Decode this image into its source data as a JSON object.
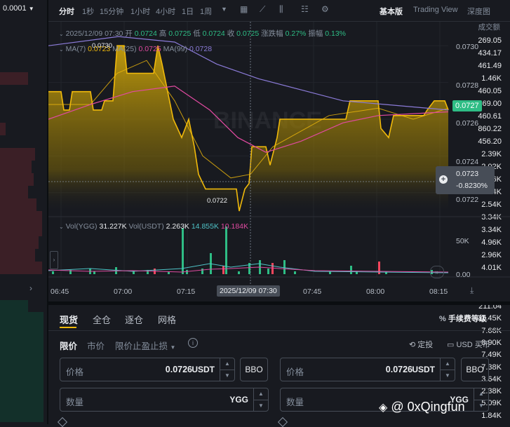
{
  "orderbook": {
    "precision": "0.0001",
    "header": "成交额",
    "asks": [
      "269.05",
      "434.17",
      "461.49",
      "1.46K",
      "460.05",
      "469.00",
      "460.61",
      "860.22",
      "456.20",
      "2.39K",
      "2.02K",
      "1.96K",
      "1.84K",
      "2.54K",
      "3.34K",
      "3.34K",
      "4.96K",
      "2.96K",
      "4.01K"
    ],
    "bids": [
      "211.04",
      "11.45K",
      "7.66K",
      "8.90K",
      "7.49K",
      "7.38K",
      "3.64K",
      "2.38K",
      "5.09K",
      "1.84K"
    ]
  },
  "toolbar": {
    "intervals": [
      "分时",
      "1秒",
      "15分钟",
      "1小时",
      "4小时",
      "1日",
      "1周"
    ],
    "active": "分时",
    "modes": [
      "基本版",
      "Trading View",
      "深度图"
    ]
  },
  "info": {
    "date": "2025/12/09 07:30",
    "open_label": "开",
    "open": "0.0724",
    "high_label": "高",
    "high": "0.0725",
    "low_label": "低",
    "low": "0.0724",
    "close_label": "收",
    "close": "0.0725",
    "change_label": "涨跌幅",
    "change": "0.27%",
    "amp_label": "振幅",
    "amp": "0.13%"
  },
  "ma": {
    "ma7_label": "MA(7)",
    "ma7": "0.0723",
    "ma25_label": "MA(25)",
    "ma25": "0.0725",
    "ma99_label": "MA(99)",
    "ma99": "0.0728"
  },
  "price_axis": [
    "0.0730",
    "0.0728",
    "0.0726",
    "0.0724",
    "0.0722"
  ],
  "current_price": "0.0727",
  "cursor": {
    "price": "0.0723",
    "pct": "-0.8230%"
  },
  "high_marker": "0.0730",
  "low_marker": "0.0722",
  "watermark": "BINANCE",
  "volume": {
    "ygg_label": "Vol(YGG)",
    "ygg": "31.227K",
    "usdt_label": "Vol(USDT)",
    "usdt": "2.263K",
    "v3": "14.855K",
    "v4": "10.184K",
    "axis_top": "50K",
    "axis_bottom": "0.00"
  },
  "time_axis": [
    "06:45",
    "07:00",
    "07:15",
    "07:45",
    "08:00",
    "08:15"
  ],
  "time_cursor": "2025/12/09 07:30",
  "order_panel": {
    "tabs": [
      "现货",
      "全仓",
      "逐仓",
      "网格"
    ],
    "fee_label": "手续费等级",
    "types": [
      "限价",
      "市价",
      "限价止盈止损"
    ],
    "settings_label": "定投",
    "usd_label": "USD 买币",
    "price_label": "价格",
    "price_value": "0.0726",
    "price_unit": "USDT",
    "qty_label": "数量",
    "qty_unit": "YGG",
    "bbo": "BBO"
  },
  "watermark_user": "@ 0xQingfun",
  "colors": {
    "accent": "#f0b90b",
    "green": "#2ebd85",
    "red": "#f6465d",
    "ma25": "#e04aa0",
    "ma99": "#8b7bd8"
  }
}
